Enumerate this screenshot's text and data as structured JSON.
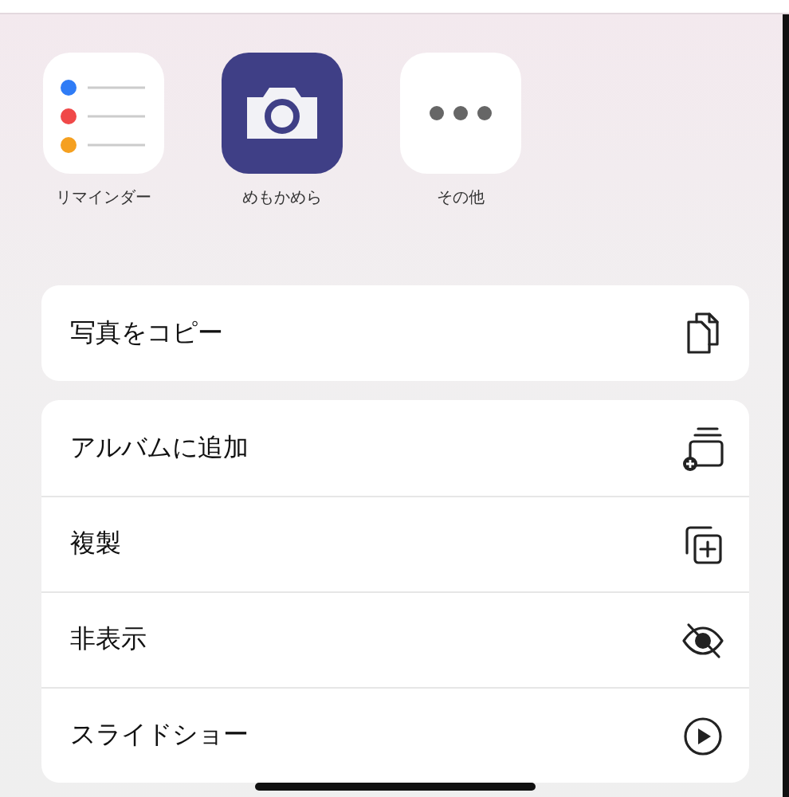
{
  "apps": [
    {
      "kind": "reminders",
      "label": "リマインダー"
    },
    {
      "kind": "camera",
      "label": "めもかめら"
    },
    {
      "kind": "more",
      "label": "その他"
    }
  ],
  "action_groups": [
    [
      {
        "kind": "copy",
        "label": "写真をコピー"
      }
    ],
    [
      {
        "kind": "album",
        "label": "アルバムに追加"
      },
      {
        "kind": "duplicate",
        "label": "複製"
      },
      {
        "kind": "hide",
        "label": "非表示"
      },
      {
        "kind": "slideshow",
        "label": "スライドショー"
      }
    ]
  ]
}
